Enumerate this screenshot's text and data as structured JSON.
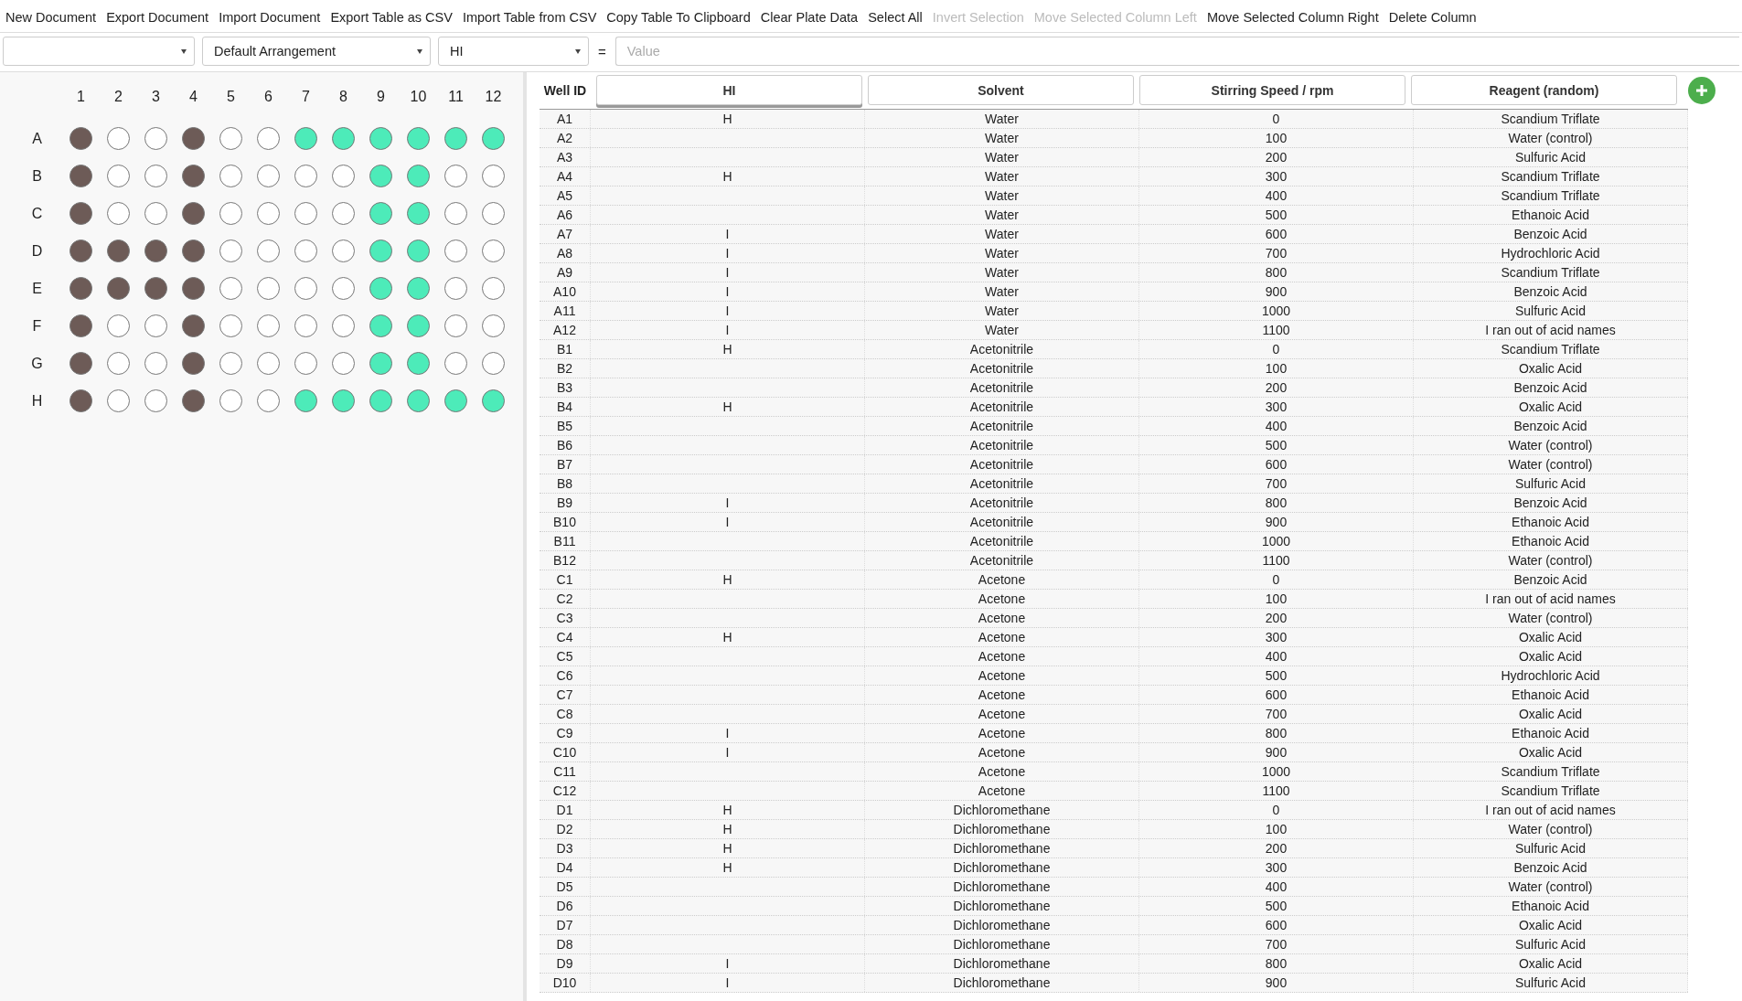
{
  "menu": [
    {
      "label": "New Document",
      "disabled": false
    },
    {
      "label": "Export Document",
      "disabled": false
    },
    {
      "label": "Import Document",
      "disabled": false
    },
    {
      "label": "Export Table as CSV",
      "disabled": false
    },
    {
      "label": "Import Table from CSV",
      "disabled": false
    },
    {
      "label": "Copy Table To Clipboard",
      "disabled": false
    },
    {
      "label": "Clear Plate Data",
      "disabled": false
    },
    {
      "label": "Select All",
      "disabled": false
    },
    {
      "label": "Invert Selection",
      "disabled": true
    },
    {
      "label": "Move Selected Column Left",
      "disabled": true
    },
    {
      "label": "Move Selected Column Right",
      "disabled": false
    },
    {
      "label": "Delete Column",
      "disabled": false
    }
  ],
  "filter": {
    "arrangement": "Default Arrangement",
    "column": "HI",
    "equals": "=",
    "placeholder": "Value"
  },
  "plate": {
    "columns": [
      "1",
      "2",
      "3",
      "4",
      "5",
      "6",
      "7",
      "8",
      "9",
      "10",
      "11",
      "12"
    ],
    "rows": [
      {
        "label": "A",
        "wells": [
          {
            "color": "#6d5b57"
          },
          {
            "color": "#ffffff"
          },
          {
            "color": "#ffffff"
          },
          {
            "color": "#6d5b57"
          },
          {
            "color": "#ffffff"
          },
          {
            "color": "#ffffff"
          },
          {
            "color": "#4debb9"
          },
          {
            "color": "#4debb9"
          },
          {
            "color": "#4debb9"
          },
          {
            "color": "#4debb9"
          },
          {
            "color": "#4debb9"
          },
          {
            "color": "#4debb9"
          }
        ]
      },
      {
        "label": "B",
        "wells": [
          {
            "color": "#6d5b57"
          },
          {
            "color": "#ffffff"
          },
          {
            "color": "#ffffff"
          },
          {
            "color": "#6d5b57"
          },
          {
            "color": "#ffffff"
          },
          {
            "color": "#ffffff"
          },
          {
            "color": "#ffffff"
          },
          {
            "color": "#ffffff"
          },
          {
            "color": "#4debb9"
          },
          {
            "color": "#4debb9"
          },
          {
            "color": "#ffffff"
          },
          {
            "color": "#ffffff"
          }
        ]
      },
      {
        "label": "C",
        "wells": [
          {
            "color": "#6d5b57"
          },
          {
            "color": "#ffffff"
          },
          {
            "color": "#ffffff"
          },
          {
            "color": "#6d5b57"
          },
          {
            "color": "#ffffff"
          },
          {
            "color": "#ffffff"
          },
          {
            "color": "#ffffff"
          },
          {
            "color": "#ffffff"
          },
          {
            "color": "#4debb9"
          },
          {
            "color": "#4debb9"
          },
          {
            "color": "#ffffff"
          },
          {
            "color": "#ffffff"
          }
        ]
      },
      {
        "label": "D",
        "wells": [
          {
            "color": "#6d5b57"
          },
          {
            "color": "#6d5b57"
          },
          {
            "color": "#6d5b57"
          },
          {
            "color": "#6d5b57"
          },
          {
            "color": "#ffffff"
          },
          {
            "color": "#ffffff"
          },
          {
            "color": "#ffffff"
          },
          {
            "color": "#ffffff"
          },
          {
            "color": "#4debb9"
          },
          {
            "color": "#4debb9"
          },
          {
            "color": "#ffffff"
          },
          {
            "color": "#ffffff"
          }
        ]
      },
      {
        "label": "E",
        "wells": [
          {
            "color": "#6d5b57"
          },
          {
            "color": "#6d5b57"
          },
          {
            "color": "#6d5b57"
          },
          {
            "color": "#6d5b57"
          },
          {
            "color": "#ffffff"
          },
          {
            "color": "#ffffff"
          },
          {
            "color": "#ffffff"
          },
          {
            "color": "#ffffff"
          },
          {
            "color": "#4debb9"
          },
          {
            "color": "#4debb9"
          },
          {
            "color": "#ffffff"
          },
          {
            "color": "#ffffff"
          }
        ]
      },
      {
        "label": "F",
        "wells": [
          {
            "color": "#6d5b57"
          },
          {
            "color": "#ffffff"
          },
          {
            "color": "#ffffff"
          },
          {
            "color": "#6d5b57"
          },
          {
            "color": "#ffffff"
          },
          {
            "color": "#ffffff"
          },
          {
            "color": "#ffffff"
          },
          {
            "color": "#ffffff"
          },
          {
            "color": "#4debb9"
          },
          {
            "color": "#4debb9"
          },
          {
            "color": "#ffffff"
          },
          {
            "color": "#ffffff"
          }
        ]
      },
      {
        "label": "G",
        "wells": [
          {
            "color": "#6d5b57"
          },
          {
            "color": "#ffffff"
          },
          {
            "color": "#ffffff"
          },
          {
            "color": "#6d5b57"
          },
          {
            "color": "#ffffff"
          },
          {
            "color": "#ffffff"
          },
          {
            "color": "#ffffff"
          },
          {
            "color": "#ffffff"
          },
          {
            "color": "#4debb9"
          },
          {
            "color": "#4debb9"
          },
          {
            "color": "#ffffff"
          },
          {
            "color": "#ffffff"
          }
        ]
      },
      {
        "label": "H",
        "wells": [
          {
            "color": "#6d5b57"
          },
          {
            "color": "#ffffff"
          },
          {
            "color": "#ffffff"
          },
          {
            "color": "#6d5b57"
          },
          {
            "color": "#ffffff"
          },
          {
            "color": "#ffffff"
          },
          {
            "color": "#4debb9"
          },
          {
            "color": "#4debb9"
          },
          {
            "color": "#4debb9"
          },
          {
            "color": "#4debb9"
          },
          {
            "color": "#4debb9"
          },
          {
            "color": "#4debb9"
          }
        ]
      }
    ]
  },
  "table": {
    "id_header": "Well ID",
    "columns": [
      {
        "label": "HI",
        "selected": true
      },
      {
        "label": "Solvent",
        "selected": false
      },
      {
        "label": "Stirring Speed / rpm",
        "selected": false
      },
      {
        "label": "Reagent (random)",
        "selected": false
      }
    ],
    "rows": [
      {
        "well": "A1",
        "hi": "H",
        "solvent": "Water",
        "speed": "0",
        "reagent": "Scandium Triflate"
      },
      {
        "well": "A2",
        "solvent": "Water",
        "speed": "100",
        "reagent": "Water (control)"
      },
      {
        "well": "A3",
        "solvent": "Water",
        "speed": "200",
        "reagent": "Sulfuric Acid"
      },
      {
        "well": "A4",
        "hi": "H",
        "solvent": "Water",
        "speed": "300",
        "reagent": "Scandium Triflate"
      },
      {
        "well": "A5",
        "solvent": "Water",
        "speed": "400",
        "reagent": "Scandium Triflate"
      },
      {
        "well": "A6",
        "solvent": "Water",
        "speed": "500",
        "reagent": "Ethanoic Acid"
      },
      {
        "well": "A7",
        "hi": "I",
        "solvent": "Water",
        "speed": "600",
        "reagent": "Benzoic Acid"
      },
      {
        "well": "A8",
        "hi": "I",
        "solvent": "Water",
        "speed": "700",
        "reagent": "Hydrochloric Acid"
      },
      {
        "well": "A9",
        "hi": "I",
        "solvent": "Water",
        "speed": "800",
        "reagent": "Scandium Triflate"
      },
      {
        "well": "A10",
        "hi": "I",
        "solvent": "Water",
        "speed": "900",
        "reagent": "Benzoic Acid"
      },
      {
        "well": "A11",
        "hi": "I",
        "solvent": "Water",
        "speed": "1000",
        "reagent": "Sulfuric Acid"
      },
      {
        "well": "A12",
        "hi": "I",
        "solvent": "Water",
        "speed": "1100",
        "reagent": "I ran out of acid names"
      },
      {
        "well": "B1",
        "hi": "H",
        "solvent": "Acetonitrile",
        "speed": "0",
        "reagent": "Scandium Triflate"
      },
      {
        "well": "B2",
        "solvent": "Acetonitrile",
        "speed": "100",
        "reagent": "Oxalic Acid"
      },
      {
        "well": "B3",
        "solvent": "Acetonitrile",
        "speed": "200",
        "reagent": "Benzoic Acid"
      },
      {
        "well": "B4",
        "hi": "H",
        "solvent": "Acetonitrile",
        "speed": "300",
        "reagent": "Oxalic Acid"
      },
      {
        "well": "B5",
        "solvent": "Acetonitrile",
        "speed": "400",
        "reagent": "Benzoic Acid"
      },
      {
        "well": "B6",
        "solvent": "Acetonitrile",
        "speed": "500",
        "reagent": "Water (control)"
      },
      {
        "well": "B7",
        "solvent": "Acetonitrile",
        "speed": "600",
        "reagent": "Water (control)"
      },
      {
        "well": "B8",
        "solvent": "Acetonitrile",
        "speed": "700",
        "reagent": "Sulfuric Acid"
      },
      {
        "well": "B9",
        "hi": "I",
        "solvent": "Acetonitrile",
        "speed": "800",
        "reagent": "Benzoic Acid"
      },
      {
        "well": "B10",
        "hi": "I",
        "solvent": "Acetonitrile",
        "speed": "900",
        "reagent": "Ethanoic Acid"
      },
      {
        "well": "B11",
        "solvent": "Acetonitrile",
        "speed": "1000",
        "reagent": "Ethanoic Acid"
      },
      {
        "well": "B12",
        "solvent": "Acetonitrile",
        "speed": "1100",
        "reagent": "Water (control)"
      },
      {
        "well": "C1",
        "hi": "H",
        "solvent": "Acetone",
        "speed": "0",
        "reagent": "Benzoic Acid"
      },
      {
        "well": "C2",
        "solvent": "Acetone",
        "speed": "100",
        "reagent": "I ran out of acid names"
      },
      {
        "well": "C3",
        "solvent": "Acetone",
        "speed": "200",
        "reagent": "Water (control)"
      },
      {
        "well": "C4",
        "hi": "H",
        "solvent": "Acetone",
        "speed": "300",
        "reagent": "Oxalic Acid"
      },
      {
        "well": "C5",
        "solvent": "Acetone",
        "speed": "400",
        "reagent": "Oxalic Acid"
      },
      {
        "well": "C6",
        "solvent": "Acetone",
        "speed": "500",
        "reagent": "Hydrochloric Acid"
      },
      {
        "well": "C7",
        "solvent": "Acetone",
        "speed": "600",
        "reagent": "Ethanoic Acid"
      },
      {
        "well": "C8",
        "solvent": "Acetone",
        "speed": "700",
        "reagent": "Oxalic Acid"
      },
      {
        "well": "C9",
        "hi": "I",
        "solvent": "Acetone",
        "speed": "800",
        "reagent": "Ethanoic Acid"
      },
      {
        "well": "C10",
        "hi": "I",
        "solvent": "Acetone",
        "speed": "900",
        "reagent": "Oxalic Acid"
      },
      {
        "well": "C11",
        "solvent": "Acetone",
        "speed": "1000",
        "reagent": "Scandium Triflate"
      },
      {
        "well": "C12",
        "solvent": "Acetone",
        "speed": "1100",
        "reagent": "Scandium Triflate"
      },
      {
        "well": "D1",
        "hi": "H",
        "solvent": "Dichloromethane",
        "speed": "0",
        "reagent": "I ran out of acid names"
      },
      {
        "well": "D2",
        "hi": "H",
        "solvent": "Dichloromethane",
        "speed": "100",
        "reagent": "Water (control)"
      },
      {
        "well": "D3",
        "hi": "H",
        "solvent": "Dichloromethane",
        "speed": "200",
        "reagent": "Sulfuric Acid"
      },
      {
        "well": "D4",
        "hi": "H",
        "solvent": "Dichloromethane",
        "speed": "300",
        "reagent": "Benzoic Acid"
      },
      {
        "well": "D5",
        "solvent": "Dichloromethane",
        "speed": "400",
        "reagent": "Water (control)"
      },
      {
        "well": "D6",
        "solvent": "Dichloromethane",
        "speed": "500",
        "reagent": "Ethanoic Acid"
      },
      {
        "well": "D7",
        "solvent": "Dichloromethane",
        "speed": "600",
        "reagent": "Oxalic Acid"
      },
      {
        "well": "D8",
        "solvent": "Dichloromethane",
        "speed": "700",
        "reagent": "Sulfuric Acid"
      },
      {
        "well": "D9",
        "hi": "I",
        "solvent": "Dichloromethane",
        "speed": "800",
        "reagent": "Oxalic Acid"
      },
      {
        "well": "D10",
        "hi": "I",
        "solvent": "Dichloromethane",
        "speed": "900",
        "reagent": "Sulfuric Acid"
      }
    ]
  }
}
